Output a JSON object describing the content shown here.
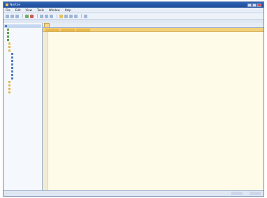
{
  "window": {
    "title": "Norton"
  },
  "menu": [
    "File",
    "Edit",
    "View",
    "Tools",
    "Window",
    "Help"
  ],
  "subbar": {
    "label": ""
  },
  "sidebar": {
    "items": [
      {
        "label": "",
        "icon": "server-icon"
      },
      {
        "label": "",
        "icon": "green-node-icon"
      },
      {
        "label": "",
        "icon": "green-node-icon"
      },
      {
        "label": "",
        "icon": "green-node-icon"
      },
      {
        "label": "",
        "icon": "green-node-icon"
      },
      {
        "label": "",
        "icon": "folder-icon"
      },
      {
        "label": "",
        "icon": "folder-icon"
      },
      {
        "label": "",
        "icon": "folder-icon"
      },
      {
        "label": "",
        "icon": "document-icon"
      },
      {
        "label": "",
        "icon": "document-icon"
      },
      {
        "label": "",
        "icon": "document-icon"
      },
      {
        "label": "",
        "icon": "document-icon"
      },
      {
        "label": "",
        "icon": "document-icon"
      },
      {
        "label": "",
        "icon": "document-icon"
      },
      {
        "label": "",
        "icon": "document-icon"
      },
      {
        "label": "",
        "icon": "document-icon"
      },
      {
        "label": "",
        "icon": "folder-icon"
      },
      {
        "label": "",
        "icon": "folder-icon"
      },
      {
        "label": "",
        "icon": "folder-icon"
      },
      {
        "label": "",
        "icon": "folder-icon"
      }
    ]
  },
  "tabs": [
    {
      "label": ""
    }
  ],
  "editor": {
    "lines": [
      "",
      "",
      "",
      "",
      "",
      "",
      "",
      "",
      "",
      "",
      "",
      "",
      "",
      "",
      "",
      "",
      "",
      "",
      "",
      "",
      "",
      "",
      "",
      "",
      "",
      "",
      "",
      "",
      "",
      "",
      "",
      "",
      "",
      "",
      "",
      "",
      "",
      "",
      "",
      "",
      ""
    ]
  },
  "status": {
    "left": "",
    "right": ""
  },
  "colors": {
    "titlebar": "#1d4a97",
    "header": "#f3d07a",
    "editor_bg": "#fffbe9"
  }
}
